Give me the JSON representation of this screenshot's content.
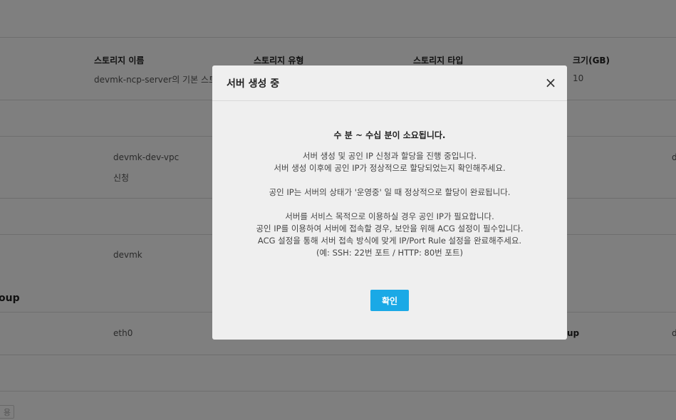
{
  "background": {
    "storage_headers": [
      "스토리지 이름",
      "스토리지 유형",
      "스토리지 타입",
      "크기(GB)"
    ],
    "storage_row": {
      "name": "devmk-ncp-server의 기본 스토리지",
      "size": "10"
    },
    "vpc_name": "devmk-dev-vpc",
    "public_ip_status": "신청",
    "right_edge_text_1": "d",
    "login_key_name": "devmk",
    "section_title_fragment": "oup",
    "nic_name": "eth0",
    "nic_group_fragment": "up",
    "right_edge_text_2": "d",
    "bottom_button_fragment": "용"
  },
  "modal": {
    "title": "서버 생성 중",
    "close_label": "×",
    "lead": "수 분 ~ 수십 분이 소요됩니다.",
    "paragraph1": [
      "서버 생성 및 공인 IP 신청과 할당을 진행 중입니다.",
      "서버 생성 이후에 공인 IP가 정상적으로 할당되었는지 확인해주세요."
    ],
    "paragraph2": [
      "공인 IP는 서버의 상태가 '운영중' 일 때 정상적으로 할당이 완료됩니다."
    ],
    "paragraph3": [
      "서버를 서비스 목적으로 이용하실 경우 공인 IP가 필요합니다.",
      "공인 IP를 이용하여 서버에 접속할 경우, 보안을 위해 ACG 설정이 필수입니다.",
      "ACG 설정을 통해 서버 접속 방식에 맞게 IP/Port Rule 설정을 완료해주세요.",
      "(예: SSH: 22번 포트 / HTTP: 80번 포트)"
    ],
    "confirm_label": "확인"
  },
  "colors": {
    "overlay": "rgba(0,0,0,0.5)",
    "modal_bg": "#efefef",
    "confirm_button": "#1aa9e6"
  }
}
